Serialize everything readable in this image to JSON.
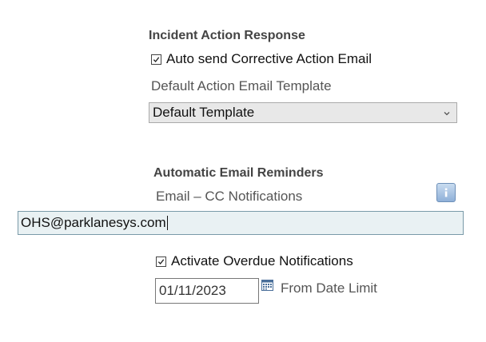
{
  "incident_action_response": {
    "title": "Incident Action Response",
    "auto_send_checkbox": {
      "label": "Auto send Corrective Action Email",
      "checked": true
    },
    "template_label": "Default Action Email Template",
    "template_select": {
      "selected": "Default Template"
    }
  },
  "automatic_email_reminders": {
    "title": "Automatic Email Reminders",
    "cc_label": "Email – CC Notifications",
    "cc_input": {
      "value": "OHS@parklanesys.com"
    },
    "overdue_checkbox": {
      "label": "Activate Overdue Notifications",
      "checked": true
    },
    "date_input": {
      "value": "01/11/2023"
    },
    "date_limit_label": "From Date Limit"
  },
  "icons": {
    "info": "info-icon",
    "calendar": "calendar-icon",
    "dropdown": "chevron-down-icon",
    "checkmark": "checkmark-icon"
  },
  "colors": {
    "input_focus_border": "#7a9aa8",
    "input_focus_bg": "#e9f1f3",
    "select_bg": "#e8e8e8",
    "info_button": "#8fb0d8"
  }
}
